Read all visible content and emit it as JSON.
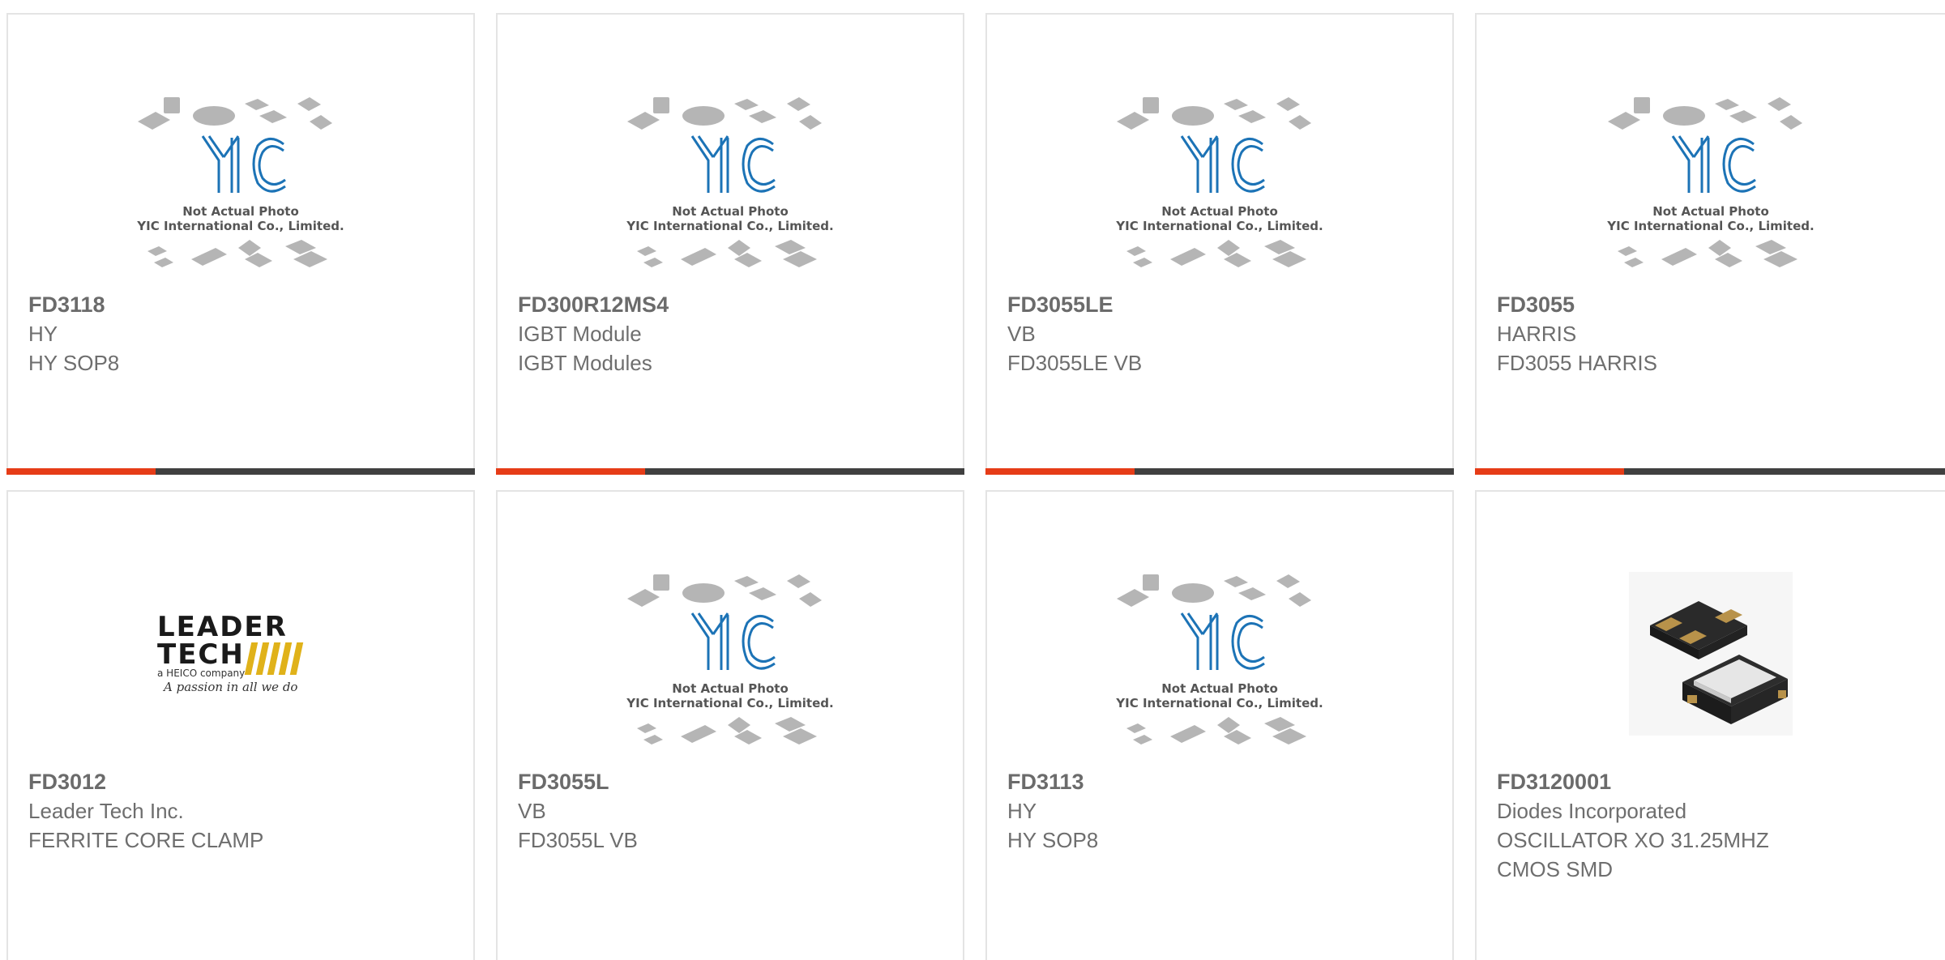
{
  "colors": {
    "accent": "#e63c17",
    "bar": "#404040",
    "text": "#6e6e6e",
    "yic_blue": "#1c73b6"
  },
  "placeholder_image": {
    "line1": "Not Actual Photo",
    "line2": "YIC International Co., Limited.",
    "logo_text": "YIC"
  },
  "products": [
    {
      "part": "FD3118",
      "manufacturer": "HY",
      "description": "HY SOP8",
      "image": "yic-placeholder"
    },
    {
      "part": "FD300R12MS4",
      "manufacturer": "IGBT Module",
      "description": "IGBT Modules",
      "image": "yic-placeholder"
    },
    {
      "part": "FD3055LE",
      "manufacturer": "VB",
      "description": "FD3055LE VB",
      "image": "yic-placeholder"
    },
    {
      "part": "FD3055",
      "manufacturer": "HARRIS",
      "description": "FD3055 HARRIS",
      "image": "yic-placeholder"
    },
    {
      "part": "FD3012",
      "manufacturer": "Leader Tech Inc.",
      "description": "FERRITE CORE CLAMP",
      "image": "leader-tech-logo",
      "logo": {
        "line1": "LEADER",
        "line2": "TECH",
        "tagline": "a HEICO company",
        "slogan": "A passion in all we do"
      }
    },
    {
      "part": "FD3055L",
      "manufacturer": "VB",
      "description": "FD3055L VB",
      "image": "yic-placeholder"
    },
    {
      "part": "FD3113",
      "manufacturer": "HY",
      "description": "HY SOP8",
      "image": "yic-placeholder"
    },
    {
      "part": "FD3120001",
      "manufacturer": "Diodes Incorporated",
      "description": "OSCILLATOR XO 31.25MHZ CMOS SMD",
      "image": "oscillator-photo"
    }
  ]
}
